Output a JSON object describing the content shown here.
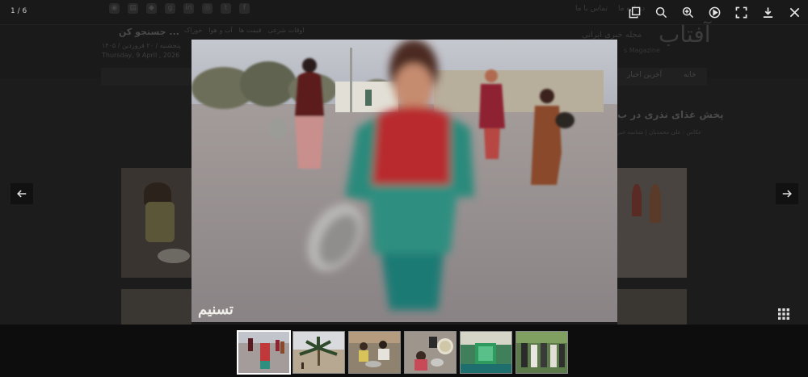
{
  "background_page": {
    "top_links": [
      "تماس با ما",
      "درباره ما"
    ],
    "search_label": "جستجو کن ...",
    "categories": [
      "اوقات شرعی",
      "قیمت ها",
      "آب و هوا",
      "خوراک"
    ],
    "date_persian": "پنجشنبه / ۲۰ فروردین / ۱۴۰۵",
    "date_english": "Thursday, 9 April , 2026",
    "logo_text": "آفتاب",
    "logo_subtitle": "مجله خبری ایرانی",
    "logo_english": "s Magazine",
    "nav_items": [
      "خانه",
      "آخرین اخبار"
    ],
    "article_title": "پخش غذای نذری در ب",
    "article_meta": "عکاس : علی محمدیان | شناسه خبر"
  },
  "lightbox": {
    "counter": "1 / 6",
    "toolbar_icons": [
      "zoom-out-icon",
      "zoom-in-icon",
      "play-icon",
      "fullscreen-icon",
      "download-icon",
      "close-icon"
    ],
    "prev_icon": "arrow-left-icon",
    "next_icon": "arrow-right-icon",
    "grid_icon": "grid-icon",
    "thumbnails": [
      {
        "name": "thumbnail-girls-with-pots",
        "active": true
      },
      {
        "name": "thumbnail-palm-tree",
        "active": false
      },
      {
        "name": "thumbnail-boy-eating",
        "active": false
      },
      {
        "name": "thumbnail-children-with-bowls",
        "active": false
      },
      {
        "name": "thumbnail-shrine-green",
        "active": false
      },
      {
        "name": "thumbnail-men-gathering",
        "active": false
      }
    ],
    "watermark_text": "تسنیم"
  },
  "colors": {
    "overlay": "#161616",
    "thumb_bar": "#0d0d0d",
    "icon": "#e6e6e6"
  }
}
